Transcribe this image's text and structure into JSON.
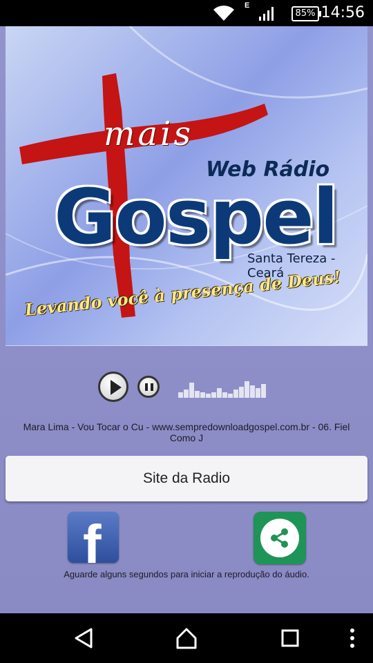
{
  "status_bar": {
    "network_type": "E",
    "battery": "85%",
    "time": "14:56"
  },
  "banner": {
    "brand_top": "mais",
    "station_label": "Web Rádio",
    "brand_name": "Gospel",
    "location": "Santa Tereza - Ceará",
    "slogan": "Levando você à presença de Deus!"
  },
  "player": {
    "now_playing": "Mara Lima - Vou Tocar o Cu - www.sempredownloadgospel.com.br - 06. Fiel Como J",
    "state": "stopped"
  },
  "site_button": {
    "label": "Site da Radio"
  },
  "social": {
    "facebook_icon": "facebook-icon",
    "share_icon": "share-icon",
    "hint": "Aguarde alguns segundos para iniciar a reprodução do áudio."
  },
  "colors": {
    "background": "#8f8fc7",
    "button_bg": "#f4f4f6",
    "facebook_blue": "#3b5998",
    "share_green": "#1e9457",
    "cross_red": "#c41414"
  }
}
